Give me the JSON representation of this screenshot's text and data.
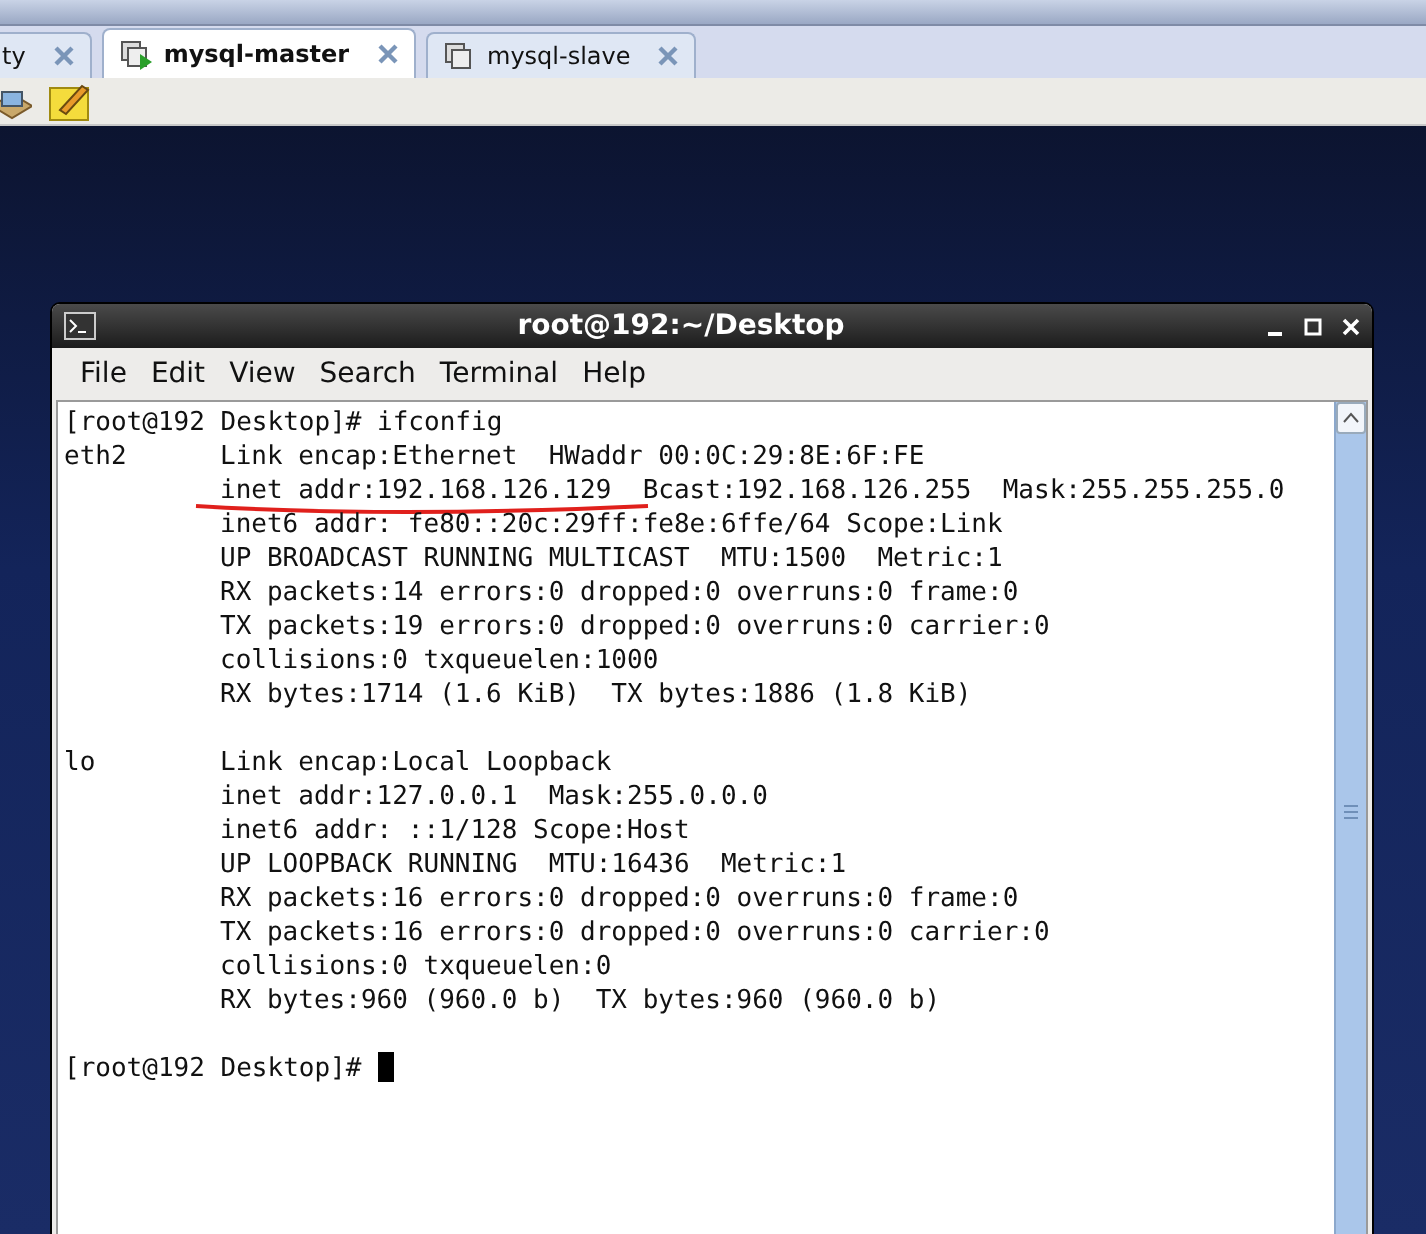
{
  "tabs": [
    {
      "label": "ty",
      "selected": false
    },
    {
      "label": "mysql-master",
      "selected": true,
      "running": true
    },
    {
      "label": "mysql-slave",
      "selected": false,
      "running": false
    }
  ],
  "terminal": {
    "title": "root@192:~/Desktop",
    "menu": [
      "File",
      "Edit",
      "View",
      "Search",
      "Terminal",
      "Help"
    ],
    "lines": [
      {
        "kind": "prompt",
        "text": "[root@192 Desktop]# ifconfig",
        "cursor": false
      },
      {
        "kind": "output",
        "label": "eth2",
        "text": "Link encap:Ethernet  HWaddr 00:0C:29:8E:6F:FE",
        "underlined": false
      },
      {
        "kind": "output",
        "text": "inet addr:192.168.126.129  Bcast:192.168.126.255  Mask:255.255.255.0",
        "underlined": true
      },
      {
        "kind": "output",
        "text": "inet6 addr: fe80::20c:29ff:fe8e:6ffe/64 Scope:Link",
        "underlined": false
      },
      {
        "kind": "output",
        "text": "UP BROADCAST RUNNING MULTICAST  MTU:1500  Metric:1",
        "underlined": false
      },
      {
        "kind": "output",
        "text": "RX packets:14 errors:0 dropped:0 overruns:0 frame:0",
        "underlined": false
      },
      {
        "kind": "output",
        "text": "TX packets:19 errors:0 dropped:0 overruns:0 carrier:0",
        "underlined": false
      },
      {
        "kind": "output",
        "text": "collisions:0 txqueuelen:1000",
        "underlined": false
      },
      {
        "kind": "output",
        "text": "RX bytes:1714 (1.6 KiB)  TX bytes:1886 (1.8 KiB)",
        "underlined": false
      },
      {
        "kind": "blank"
      },
      {
        "kind": "output",
        "label": "lo",
        "text": "Link encap:Local Loopback",
        "underlined": false
      },
      {
        "kind": "output",
        "text": "inet addr:127.0.0.1  Mask:255.0.0.0",
        "underlined": false
      },
      {
        "kind": "output",
        "text": "inet6 addr: ::1/128 Scope:Host",
        "underlined": false
      },
      {
        "kind": "output",
        "text": "UP LOOPBACK RUNNING  MTU:16436  Metric:1",
        "underlined": false
      },
      {
        "kind": "output",
        "text": "RX packets:16 errors:0 dropped:0 overruns:0 frame:0",
        "underlined": false
      },
      {
        "kind": "output",
        "text": "TX packets:16 errors:0 dropped:0 overruns:0 carrier:0",
        "underlined": false
      },
      {
        "kind": "output",
        "text": "collisions:0 txqueuelen:0",
        "underlined": false
      },
      {
        "kind": "output",
        "text": "RX bytes:960 (960.0 b)  TX bytes:960 (960.0 b)",
        "underlined": false
      },
      {
        "kind": "blank"
      },
      {
        "kind": "prompt",
        "text": "[root@192 Desktop]# ",
        "cursor": true
      }
    ]
  }
}
